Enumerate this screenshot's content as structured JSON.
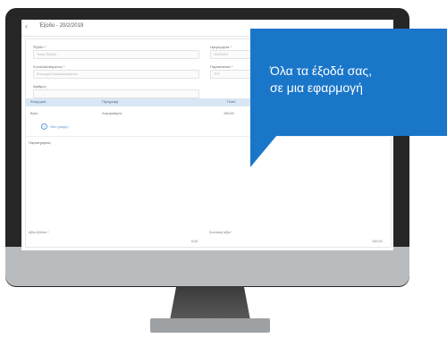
{
  "app": {
    "window_title": "Έξοδο - 20/2/2019"
  },
  "form": {
    "field1_label": "Έξοδο *",
    "field1_value": "Τύπος Εξόδου",
    "field2_label": "Ημερομηνία *",
    "field2_value": "20/2/2019",
    "field3_label": "Συναλλασσόμενος *",
    "field3_value": "Επωνυμία Συναλλασσόμενου",
    "field4_label": "Παραστατικό *",
    "field4_value": "ΤΠΥ",
    "field5_label": "Αριθμός",
    "field5_value": ""
  },
  "table": {
    "headers": [
      "Κατηγορία",
      "Περιγραφή",
      "Ποσό"
    ],
    "rows": [
      {
        "category": "Άλλο",
        "description": "Λογαριασμός",
        "amount": "100,00"
      }
    ],
    "add_line_label": "Νέα γραμμή"
  },
  "notes_label": "Παρατηρήσεις",
  "footer": {
    "left_label": "Αξία εξόδου *",
    "left_value": "0,00",
    "right_label": "Συνολική αξία *",
    "right_value": "100,00"
  },
  "callout": {
    "line1": "Όλα τα έξοδά σας,",
    "line2": "σε μια εφαρμογή"
  }
}
